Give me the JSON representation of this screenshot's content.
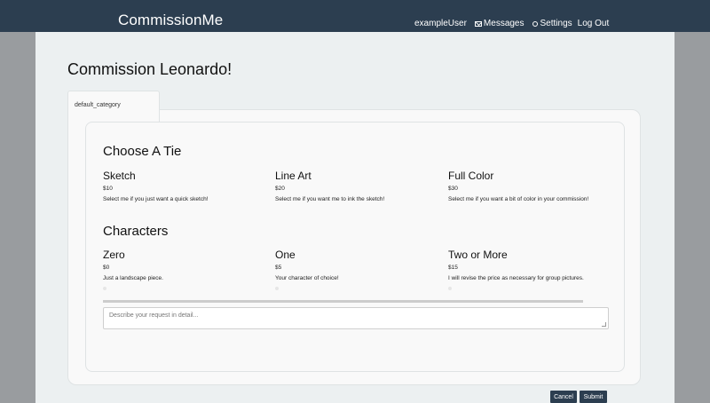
{
  "header": {
    "brand": "CommissionMe",
    "user": "exampleUser",
    "messages": "Messages",
    "settings": "Settings",
    "logout": "Log Out"
  },
  "page": {
    "title": "Commission Leonardo!",
    "tab_label": "default_category"
  },
  "tier_section": {
    "title": "Choose A Tie",
    "options": [
      {
        "name": "Sketch",
        "price": "$10",
        "description": "Select me if you just want a quick sketch!"
      },
      {
        "name": "Line Art",
        "price": "$20",
        "description": "Select me if you want me to ink the sketch!"
      },
      {
        "name": "Full Color",
        "price": "$30",
        "description": "Select me if you want a bit of color in your commission!"
      }
    ]
  },
  "characters_section": {
    "title": "Characters",
    "options": [
      {
        "name": "Zero",
        "price": "$0",
        "description": "Just a landscape piece."
      },
      {
        "name": "One",
        "price": "$5",
        "description": "Your character of choice!"
      },
      {
        "name": "Two or More",
        "price": "$15",
        "description": "I will revise the price as necessary for group pictures."
      }
    ]
  },
  "request": {
    "placeholder": "Describe your request in detail..."
  },
  "actions": {
    "cancel": "Cancel",
    "submit": "Submit"
  },
  "colors": {
    "navbar": "#2c3e50",
    "page_bg": "#ecf0f1",
    "outer_bg": "#999c9f",
    "button": "#2c3e50"
  }
}
